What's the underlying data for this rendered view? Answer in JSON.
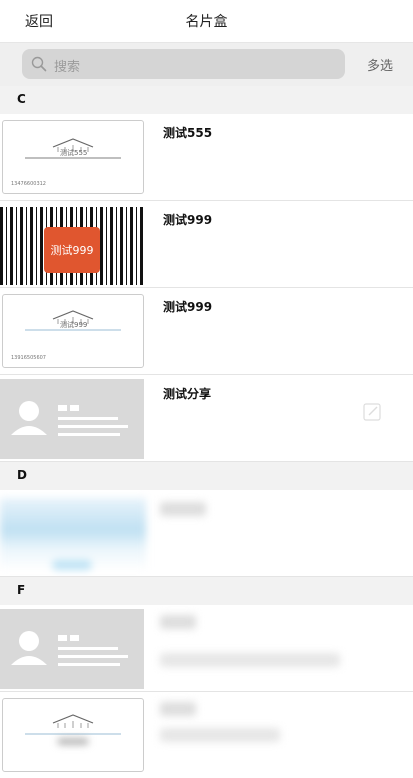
{
  "nav": {
    "back_label": "返回",
    "title": "名片盒"
  },
  "search": {
    "placeholder": "搜索",
    "multi_select_label": "多选"
  },
  "sections": [
    {
      "letter": "C",
      "items": [
        {
          "name": "测试555",
          "card_text": "测试555",
          "phone": "13476600312"
        },
        {
          "name": "测试999",
          "sticker_text": "测试999"
        },
        {
          "name": "测试999",
          "card_text": "测试999",
          "phone": "13916505607"
        },
        {
          "name": "测试分享"
        }
      ]
    },
    {
      "letter": "D"
    },
    {
      "letter": "F"
    }
  ],
  "colors": {
    "sticker": "#e0562f",
    "section_bg": "#f2f2f2",
    "search_bg": "#d5d5d5"
  }
}
